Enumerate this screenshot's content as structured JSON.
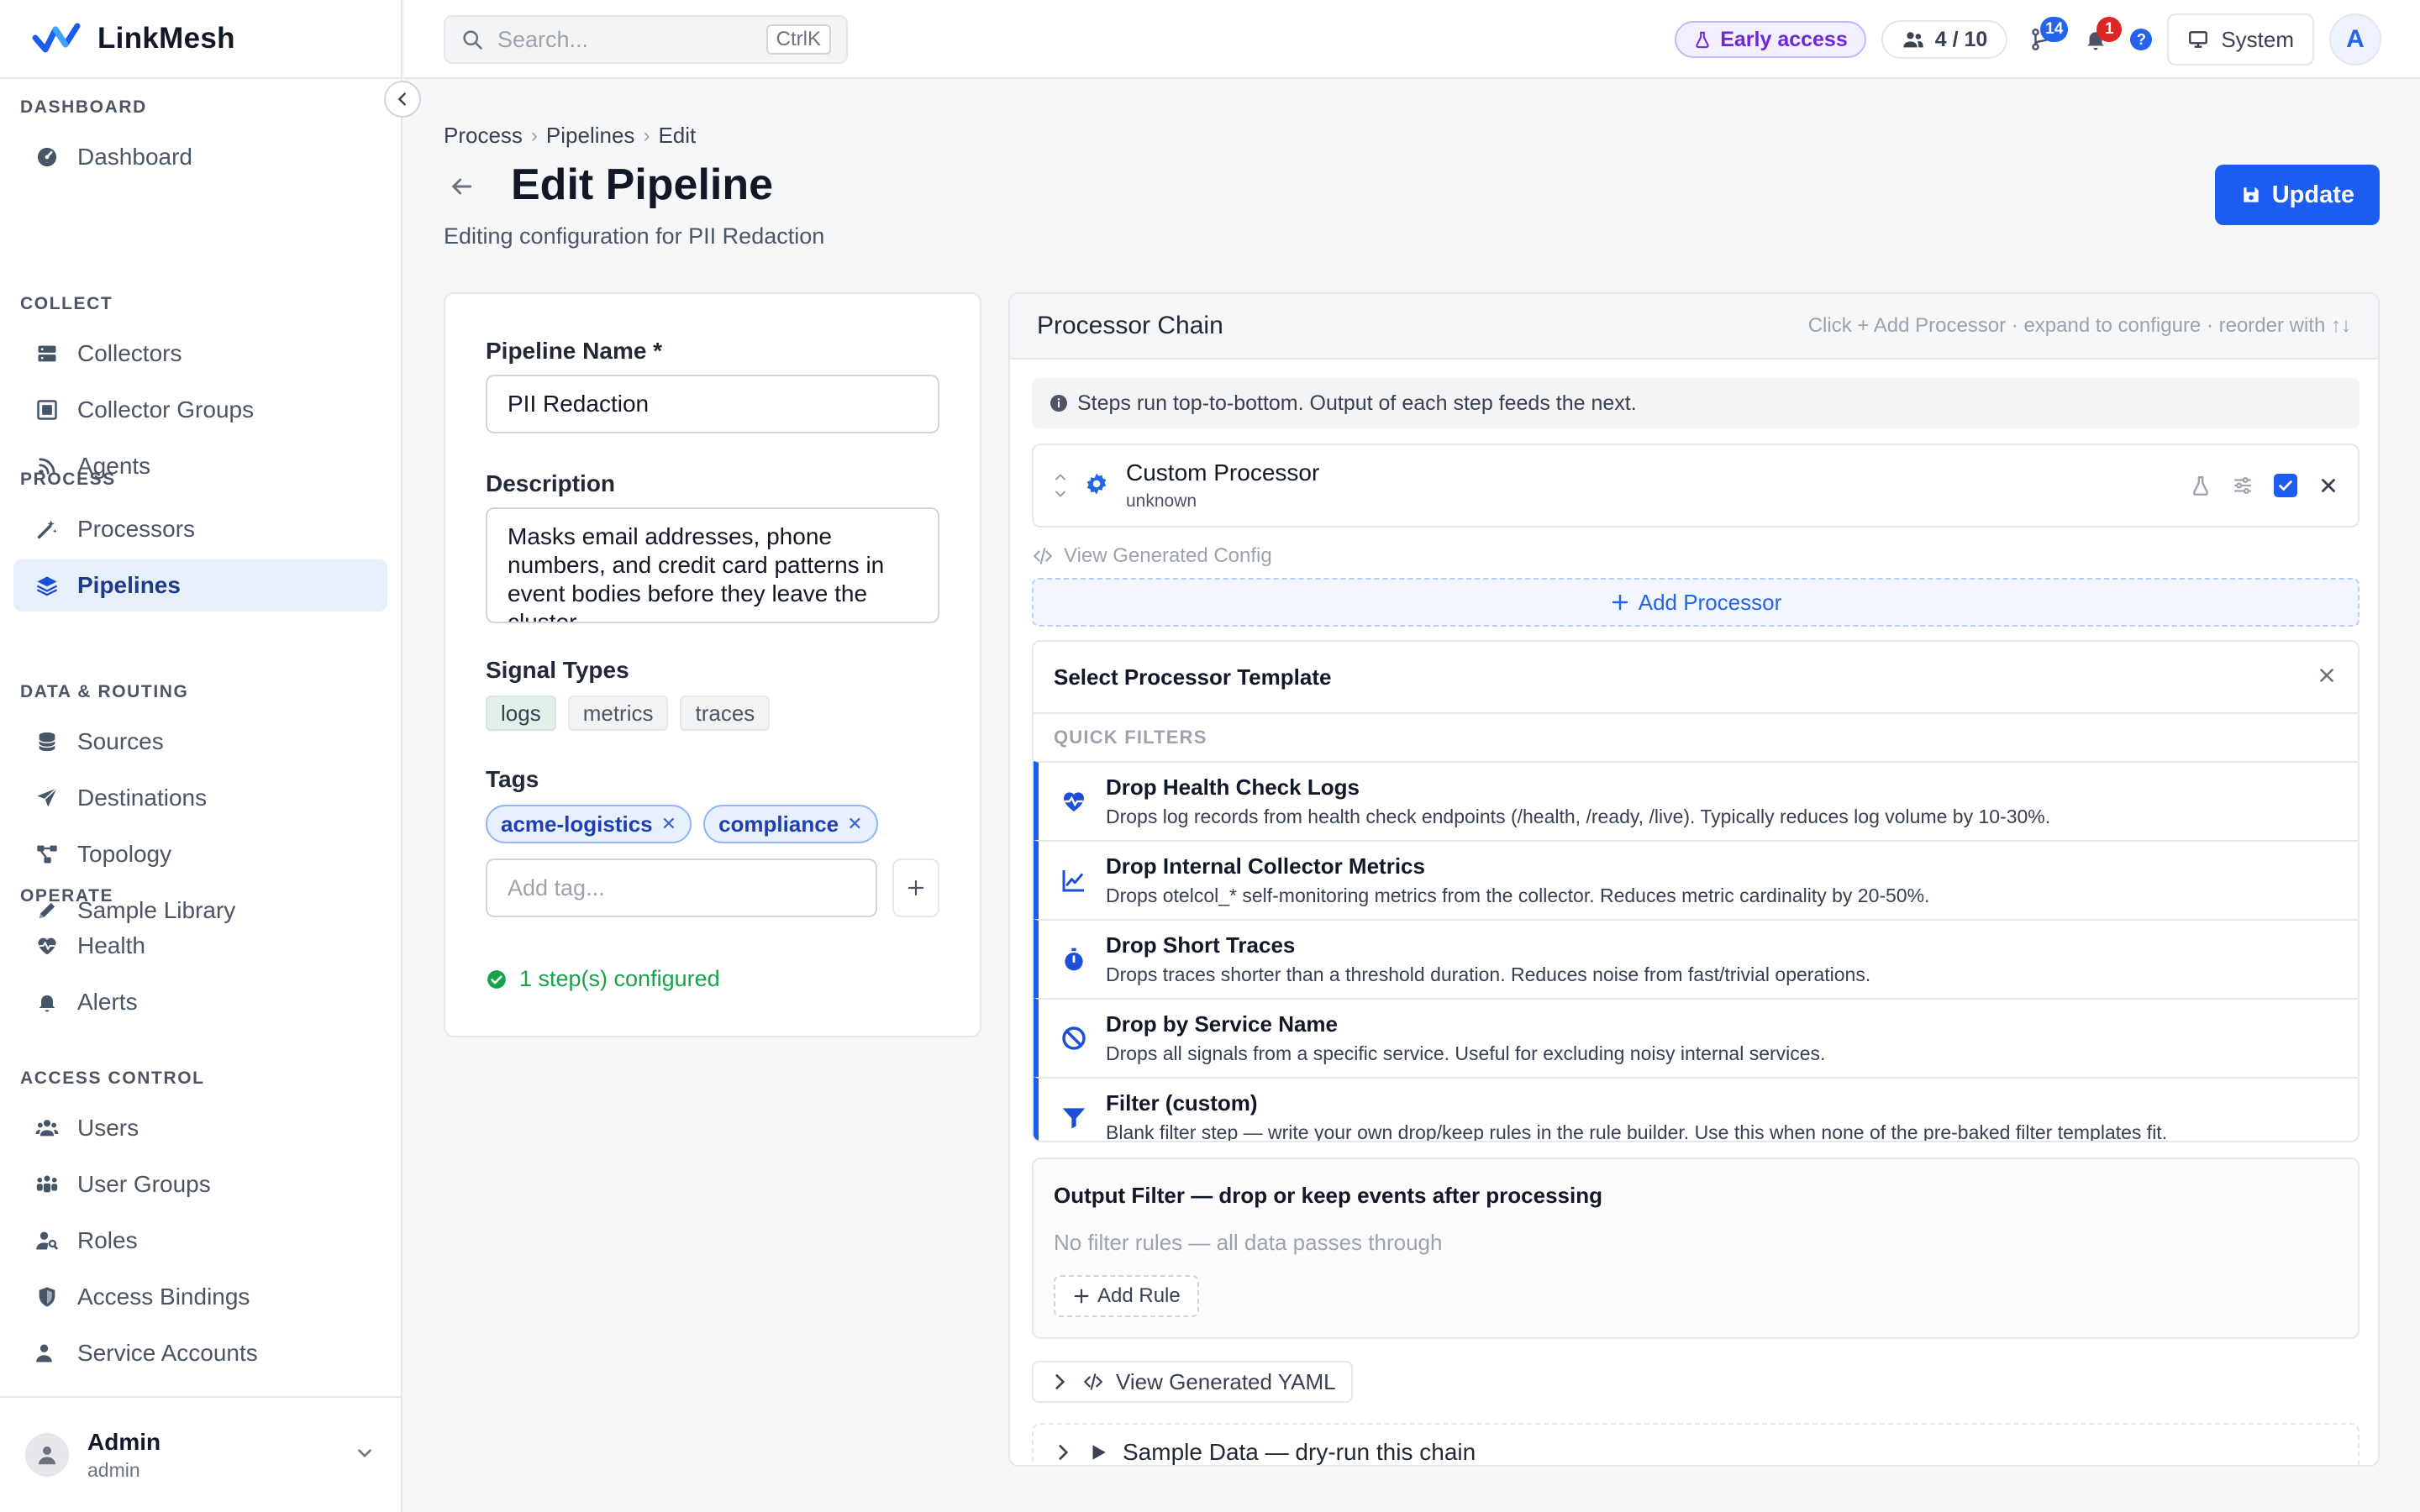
{
  "app": {
    "name": "LinkMesh"
  },
  "sidebar": {
    "sections": [
      {
        "heading": "DASHBOARD",
        "items": [
          {
            "label": "Dashboard",
            "icon": "dashboard-icon"
          }
        ]
      },
      {
        "heading": "COLLECT",
        "items": [
          {
            "label": "Collectors",
            "icon": "server-icon"
          },
          {
            "label": "Collector Groups",
            "icon": "collector-groups-icon"
          },
          {
            "label": "Agents",
            "icon": "antenna-icon"
          }
        ]
      },
      {
        "heading": "PROCESS",
        "items": [
          {
            "label": "Processors",
            "icon": "magic-wand-icon"
          },
          {
            "label": "Pipelines",
            "icon": "layers-icon",
            "active": true
          }
        ]
      },
      {
        "heading": "DATA & ROUTING",
        "items": [
          {
            "label": "Sources",
            "icon": "database-icon"
          },
          {
            "label": "Destinations",
            "icon": "send-icon"
          },
          {
            "label": "Topology",
            "icon": "topology-icon"
          },
          {
            "label": "Sample Library",
            "icon": "pen-icon"
          }
        ]
      },
      {
        "heading": "OPERATE",
        "items": [
          {
            "label": "Health",
            "icon": "heartbeat-icon"
          },
          {
            "label": "Alerts",
            "icon": "bell-icon"
          }
        ]
      },
      {
        "heading": "ACCESS CONTROL",
        "items": [
          {
            "label": "Users",
            "icon": "users-icon"
          },
          {
            "label": "User Groups",
            "icon": "user-groups-icon"
          },
          {
            "label": "Roles",
            "icon": "user-key-icon"
          },
          {
            "label": "Access Bindings",
            "icon": "shield-icon"
          },
          {
            "label": "Service Accounts",
            "icon": "service-account-icon"
          }
        ]
      }
    ],
    "footer": {
      "name": "Admin",
      "role": "admin"
    }
  },
  "topbar": {
    "search_placeholder": "Search...",
    "search_shortcut": "CtrlK",
    "early_access": "Early access",
    "seats": "4 / 10",
    "git_badge": "14",
    "alerts_badge": "1",
    "help": "?",
    "theme_label": "System",
    "user_initial": "A"
  },
  "page": {
    "breadcrumb": [
      "Process",
      "Pipelines",
      "Edit"
    ],
    "title": "Edit Pipeline",
    "subtitle": "Editing configuration for PII Redaction",
    "update_label": "Update"
  },
  "form": {
    "name_label": "Pipeline Name *",
    "name_value": "PII Redaction",
    "description_label": "Description",
    "description_value": "Masks email addresses, phone numbers, and credit card patterns in event bodies before they leave the cluster.",
    "signal_label": "Signal Types",
    "signals": [
      {
        "label": "logs",
        "selected": true
      },
      {
        "label": "metrics",
        "selected": false
      },
      {
        "label": "traces",
        "selected": false
      }
    ],
    "tags_label": "Tags",
    "tags": [
      "acme-logistics",
      "compliance"
    ],
    "tag_placeholder": "Add tag...",
    "steps_status": "1 step(s) configured"
  },
  "chain": {
    "title": "Processor Chain",
    "hint": "Click + Add Processor · expand to configure · reorder with ↑↓",
    "info": "Steps run top-to-bottom. Output of each step feeds the next.",
    "processor": {
      "name": "Custom Processor",
      "type": "unknown"
    },
    "view_config_label": "View Generated Config",
    "add_processor_label": "Add Processor",
    "template_panel": {
      "title": "Select Processor Template",
      "quick_filters_heading": "QUICK FILTERS",
      "templates": [
        {
          "name": "Drop Health Check Logs",
          "desc": "Drops log records from health check endpoints (/health, /ready, /live). Typically reduces log volume by 10-30%.",
          "icon": "heart-pulse-icon"
        },
        {
          "name": "Drop Internal Collector Metrics",
          "desc": "Drops otelcol_* self-monitoring metrics from the collector. Reduces metric cardinality by 20-50%.",
          "icon": "line-chart-icon"
        },
        {
          "name": "Drop Short Traces",
          "desc": "Drops traces shorter than a threshold duration. Reduces noise from fast/trivial operations.",
          "icon": "stopwatch-icon"
        },
        {
          "name": "Drop by Service Name",
          "desc": "Drops all signals from a specific service. Useful for excluding noisy internal services.",
          "icon": "ban-icon"
        },
        {
          "name": "Filter (custom)",
          "desc": "Blank filter step — write your own drop/keep rules in the rule builder. Use this when none of the pre-baked filter templates fit.",
          "icon": "funnel-icon"
        }
      ]
    },
    "output_filter": {
      "title": "Output Filter — drop or keep events after processing",
      "empty": "No filter rules — all data passes through",
      "add_rule_label": "Add Rule"
    },
    "yaml_label": "View Generated YAML",
    "sample_label": "Sample Data — dry-run this chain"
  }
}
